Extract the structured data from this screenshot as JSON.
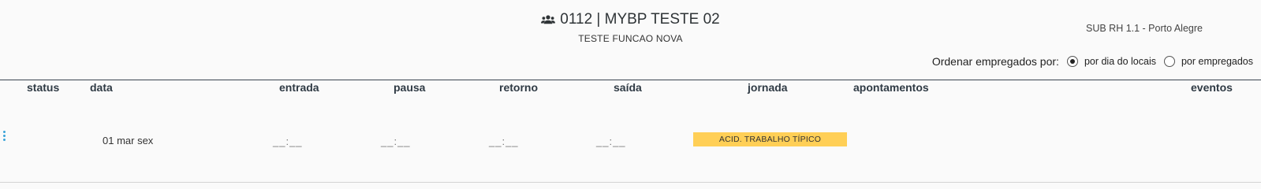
{
  "header": {
    "title": "0112 | MYBP TESTE 02",
    "subtitle": "TESTE FUNCAO NOVA",
    "location": "SUB RH 1.1 - Porto Alegre"
  },
  "sort": {
    "label": "Ordenar empregados por:",
    "options": [
      {
        "label": "por dia do locais",
        "selected": true
      },
      {
        "label": "por empregados",
        "selected": false
      }
    ]
  },
  "columns": {
    "status": "status",
    "data": "data",
    "entrada": "entrada",
    "pausa": "pausa",
    "retorno": "retorno",
    "saida": "saída",
    "jornada": "jornada",
    "apontamentos": "apontamentos",
    "eventos": "eventos"
  },
  "rows": [
    {
      "date": "01 mar sex",
      "entrada": "__:__",
      "pausa": "__:__",
      "retorno": "__:__",
      "saida": "__:__",
      "jornada": "ACID. TRABALHO TÍPICO"
    }
  ],
  "colors": {
    "accent": "#3aa3d8",
    "badge": "#ffcf56",
    "rule": "#3a4450"
  }
}
